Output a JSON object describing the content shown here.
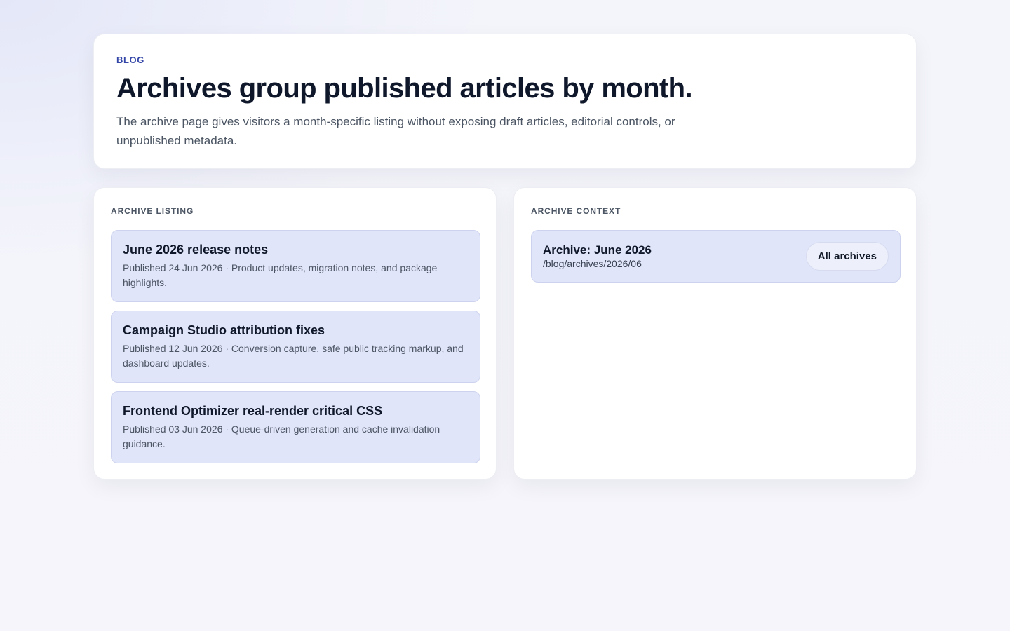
{
  "hero": {
    "eyebrow": "BLOG",
    "title": "Archives group published articles by month.",
    "description": "The archive page gives visitors a month-specific listing without exposing draft articles, editorial controls, or unpublished metadata."
  },
  "listing": {
    "heading": "ARCHIVE LISTING",
    "articles": [
      {
        "title": "June 2026 release notes",
        "meta": "Published 24 Jun 2026 · Product updates, migration notes, and package highlights."
      },
      {
        "title": "Campaign Studio attribution fixes",
        "meta": "Published 12 Jun 2026 · Conversion capture, safe public tracking markup, and dashboard updates."
      },
      {
        "title": "Frontend Optimizer real-render critical CSS",
        "meta": "Published 03 Jun 2026 · Queue-driven generation and cache invalidation guidance."
      }
    ]
  },
  "context": {
    "heading": "ARCHIVE CONTEXT",
    "archive_title": "Archive: June 2026",
    "archive_path": "/blog/archives/2026/06",
    "all_archives_label": "All archives"
  },
  "colors": {
    "accent": "#3447a8",
    "card_bg": "#e1e5f9",
    "card_border": "#cdd3ee",
    "heading": "#0f172a",
    "muted": "#4b5563"
  }
}
